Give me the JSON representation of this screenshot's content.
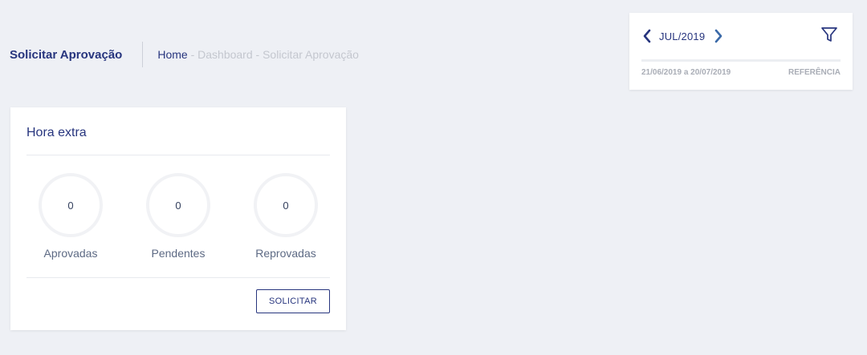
{
  "header": {
    "title": "Solicitar Aprovação",
    "breadcrumb": {
      "home": "Home",
      "separator": " - ",
      "items": [
        "Dashboard",
        "Solicitar Aprovação"
      ]
    }
  },
  "period": {
    "label": "JUL/2019",
    "range": "21/06/2019 a 20/07/2019",
    "reference_label": "REFERÊNCIA",
    "icons": {
      "prev": "chevron-left-icon",
      "next": "chevron-right-icon",
      "filter": "filter-icon"
    }
  },
  "overtime": {
    "title": "Hora extra",
    "stats": [
      {
        "value": "0",
        "label": "Aprovadas"
      },
      {
        "value": "0",
        "label": "Pendentes"
      },
      {
        "value": "0",
        "label": "Reprovadas"
      }
    ],
    "action_label": "SOLICITAR"
  },
  "colors": {
    "primary": "#27357e",
    "background": "#eef0f5",
    "muted": "#c4c7cf",
    "accent_chevron_right": "#3b6aa8"
  }
}
